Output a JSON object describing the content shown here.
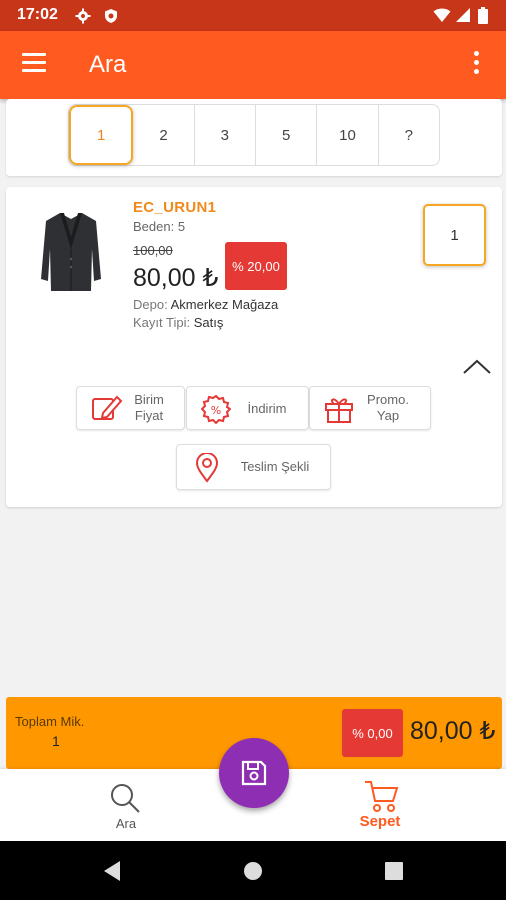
{
  "status_bar": {
    "time": "17:02"
  },
  "app_bar": {
    "title": "Ara"
  },
  "quantity_options": [
    "1",
    "2",
    "3",
    "5",
    "10",
    "?"
  ],
  "product": {
    "code": "EC_URUN1",
    "size": "Beden: 5",
    "old_price": "100,00",
    "price": "80,00 ₺",
    "discount": "% 20,00",
    "depot_label": "Depo: ",
    "depot_value": "Akmerkez Mağaza",
    "record_label": "Kayıt Tipi: ",
    "record_value": "Satış",
    "quantity": "1"
  },
  "actions": {
    "unit_price": "Birim\nFiyat",
    "discount": "İndirim",
    "promo": "Promo.\nYap",
    "delivery": "Teslim Şekli"
  },
  "totals": {
    "label": "Toplam Mik.",
    "quantity": "1",
    "discount": "% 0,00",
    "price": "80,00 ₺"
  },
  "bottom_nav": {
    "search": "Ara",
    "cart": "Sepet"
  },
  "colors": {
    "app_bar": "#ff5a1f",
    "status_bar": "#c8361a",
    "accent_orange": "#f5a623",
    "discount_red": "#e53935",
    "totals_bar": "#ff9800",
    "fab": "#8e2fb3",
    "active_nav": "#ff5a1f"
  }
}
